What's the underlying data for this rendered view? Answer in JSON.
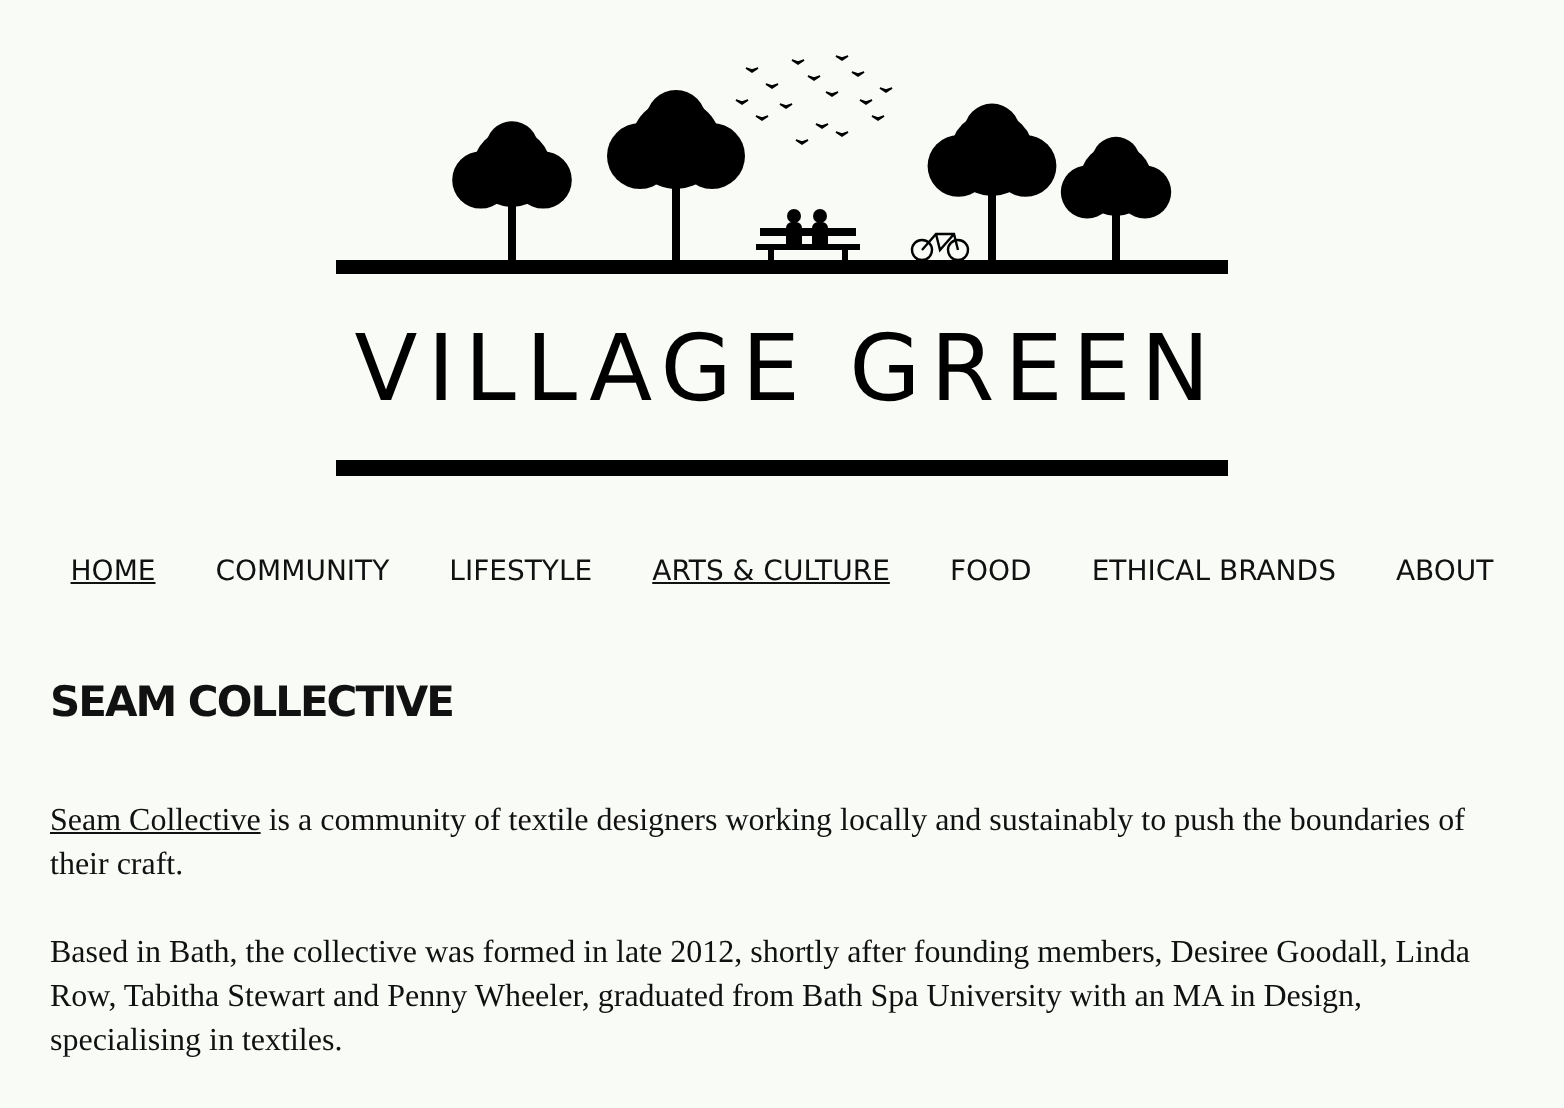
{
  "logo": {
    "title": "VILLAGE GREEN"
  },
  "nav": [
    {
      "label": "HOME",
      "active": true
    },
    {
      "label": "COMMUNITY",
      "active": false
    },
    {
      "label": "LIFESTYLE",
      "active": false
    },
    {
      "label": "ARTS & CULTURE",
      "active": true
    },
    {
      "label": "FOOD",
      "active": false
    },
    {
      "label": "ETHICAL BRANDS",
      "active": false
    },
    {
      "label": "ABOUT",
      "active": false
    }
  ],
  "article": {
    "heading": "SEAM COLLECTIVE",
    "paragraphs": [
      {
        "link": "Seam Collective",
        "text": " is a community of textile designers working locally and sustainably to push the boundaries of their craft."
      },
      {
        "text": "Based in Bath, the collective was formed in late 2012, shortly after founding members, Desiree Goodall, Linda Row, Tabitha Stewart and Penny Wheeler, graduated from Bath Spa University with an MA in Design, specialising in textiles."
      }
    ]
  }
}
